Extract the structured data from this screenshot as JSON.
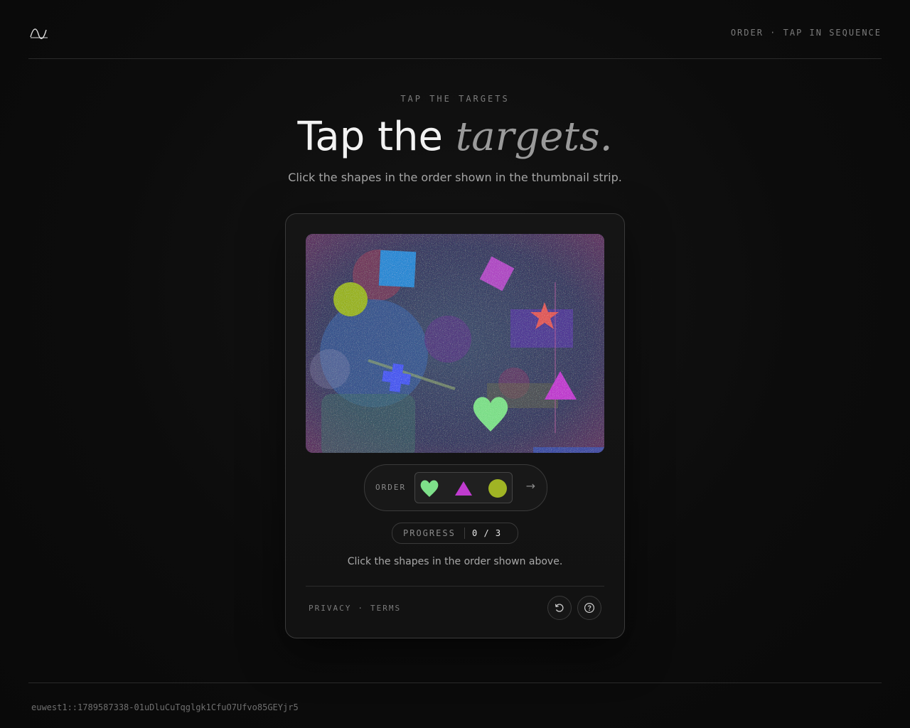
{
  "header": {
    "logo_icon": "wave-logo-icon",
    "right_label": "ORDER · TAP IN SEQUENCE"
  },
  "hero": {
    "eyebrow": "TAP THE TARGETS",
    "title_main": "Tap the ",
    "title_accent": "targets.",
    "subtitle": "Click the shapes in the order shown in the thumbnail strip."
  },
  "challenge": {
    "order_label": "ORDER",
    "sequence": [
      "heart",
      "triangle",
      "circle"
    ],
    "sequence_colors": [
      "#7ee08a",
      "#c03ccf",
      "#a0b424"
    ],
    "next_icon": "arrow-right-icon",
    "progress_label": "PROGRESS",
    "progress_value": "0 / 3",
    "hint": "Click the shapes in the order shown above."
  },
  "footer_links": {
    "privacy": "PRIVACY",
    "separator": "·",
    "terms": "TERMS"
  },
  "actions": {
    "refresh_icon": "refresh-icon",
    "help_icon": "help-icon"
  },
  "session_id": "euwest1::1789587338-01uDluCuTqglgk1CfuO7Ufvo85GEYjr5",
  "colors": {
    "background": "#0c0c0c",
    "card_border": "#3a3a3a",
    "accent_text": "#9a9a9a"
  }
}
